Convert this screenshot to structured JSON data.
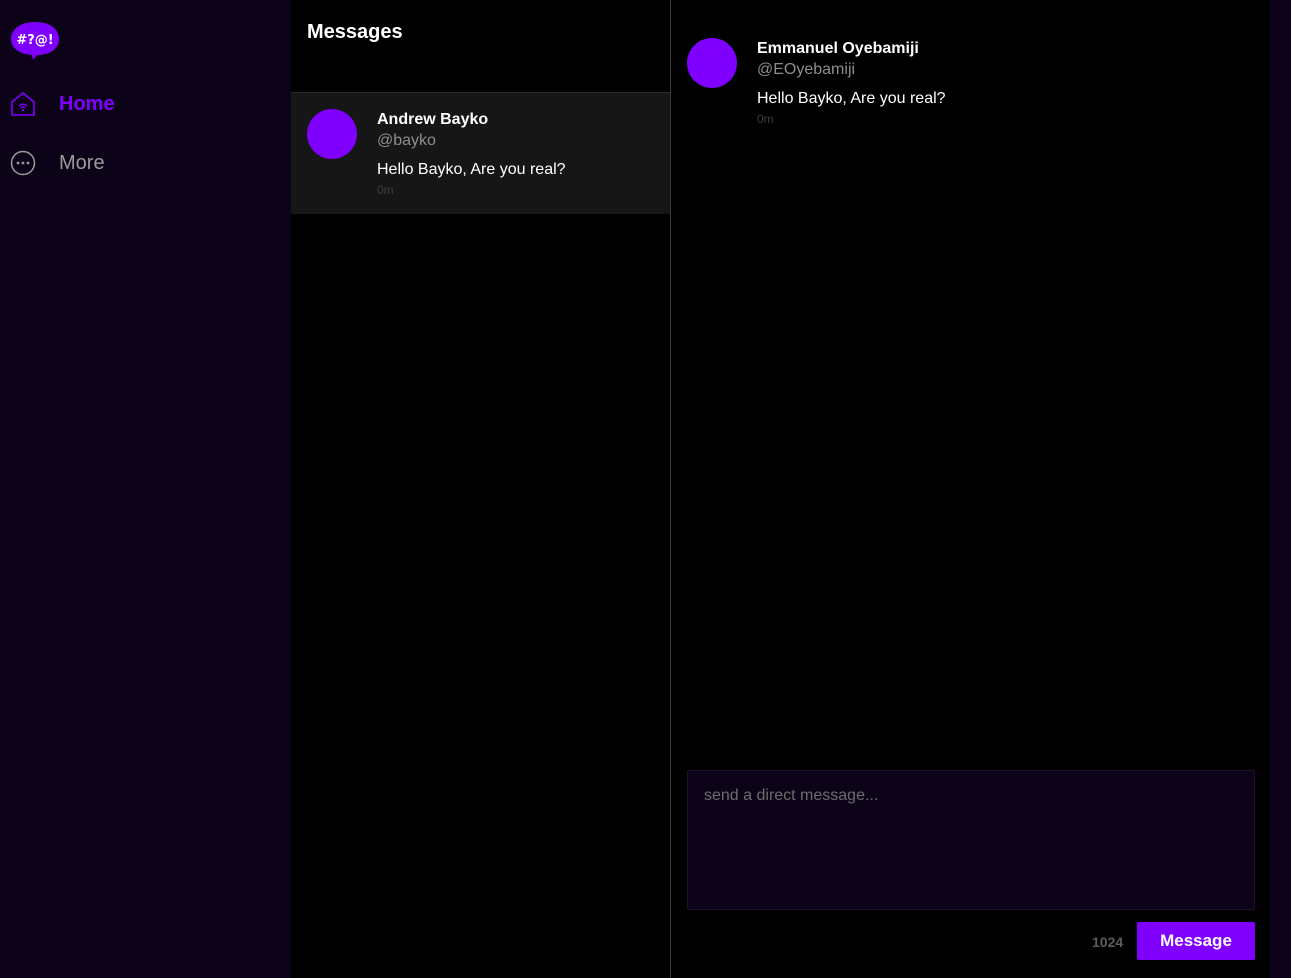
{
  "brand": {
    "logo_text": "#?@!",
    "accent": "#8000ff",
    "bg_dark": "#0d0319"
  },
  "sidebar": {
    "items": [
      {
        "label": "Home",
        "icon": "home-icon",
        "active": true
      },
      {
        "label": "More",
        "icon": "more-icon",
        "active": false
      }
    ]
  },
  "messages": {
    "title": "Messages",
    "conversations": [
      {
        "name": "Andrew Bayko",
        "handle": "@bayko",
        "text": "Hello Bayko, Are you real?",
        "time": "0m"
      }
    ]
  },
  "chat": {
    "messages": [
      {
        "name": "Emmanuel Oyebamiji",
        "handle": "@EOyebamiji",
        "text": "Hello Bayko, Are you real?",
        "time": "0m"
      }
    ],
    "composer_placeholder": "send a direct message...",
    "char_count": "1024",
    "send_label": "Message"
  }
}
